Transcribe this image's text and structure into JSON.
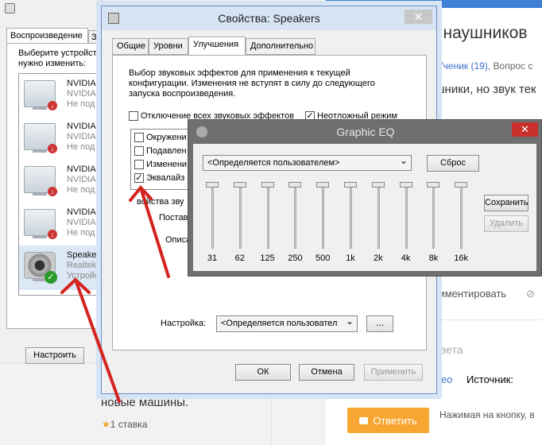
{
  "web": {
    "question_title": "а наушников",
    "meta_author": "й Ученик (19),",
    "meta_rest": " Вопрос с",
    "question_text": "ушники, но звук тек",
    "comment_action": "Комментировать",
    "answer_placeholder": "ответа",
    "video_link": "идео",
    "source_label": "Источник:",
    "answer_button": "Ответить",
    "hint": "Нажимая на кнопку, в",
    "answer_text": "новые машины.",
    "rating": "1 ставка",
    "colors": {
      "brand_blue": "#3f7fd6",
      "answer_orange": "#f7a631"
    }
  },
  "sound_window": {
    "tab_playback": "Воспроизведение",
    "tab_record": "Зап",
    "hint_line1": "Выберите устройст",
    "hint_line2": "нужно изменить:",
    "devices": [
      {
        "name": "NVIDIA",
        "d1": "NVIDIA",
        "d2": "Не под"
      },
      {
        "name": "NVIDIA",
        "d1": "NVIDIA",
        "d2": "Не под"
      },
      {
        "name": "NVIDIA",
        "d1": "NVIDIA",
        "d2": "Не под"
      },
      {
        "name": "NVIDIA",
        "d1": "NVIDIA",
        "d2": "Не под"
      },
      {
        "name": "Speake",
        "d1": "Realtek",
        "d2": "Устройс"
      }
    ],
    "configure_button": "Настроить"
  },
  "properties": {
    "title": "Свойства: Speakers",
    "tabs": [
      "Общие",
      "Уровни",
      "Улучшения",
      "Дополнительно"
    ],
    "active_tab": "Улучшения",
    "description": "Выбор звуковых эффектов для применения к текущей конфигурации. Изменения не вступят в силу до следующего запуска воспроизведения.",
    "disable_all": "Отключение всех звуковых эффектов",
    "immediate_mode": "Неотложный режим",
    "effects": [
      {
        "label": "Окружени",
        "checked": false
      },
      {
        "label": "Подавлен",
        "checked": false
      },
      {
        "label": "Изменени",
        "checked": false
      },
      {
        "label": "Эквалайз",
        "checked": true
      }
    ],
    "props_label": "войства зву",
    "provider_label": "Поставщ",
    "description_label": "Описа",
    "setting_label": "Настройка:",
    "setting_value": "<Определяется пользовател",
    "dots_button": "...",
    "ok": "ОК",
    "cancel": "Отмена",
    "apply": "Применить"
  },
  "eq": {
    "title": "Graphic EQ",
    "preset": "<Определяется пользователем>",
    "reset": "Сброс",
    "save": "Сохранить",
    "delete": "Удалить",
    "bands": [
      "31",
      "62",
      "125",
      "250",
      "500",
      "1k",
      "2k",
      "4k",
      "8k",
      "16k"
    ],
    "levels": [
      0,
      0,
      0,
      0,
      0,
      0,
      0,
      0,
      0,
      0
    ]
  }
}
